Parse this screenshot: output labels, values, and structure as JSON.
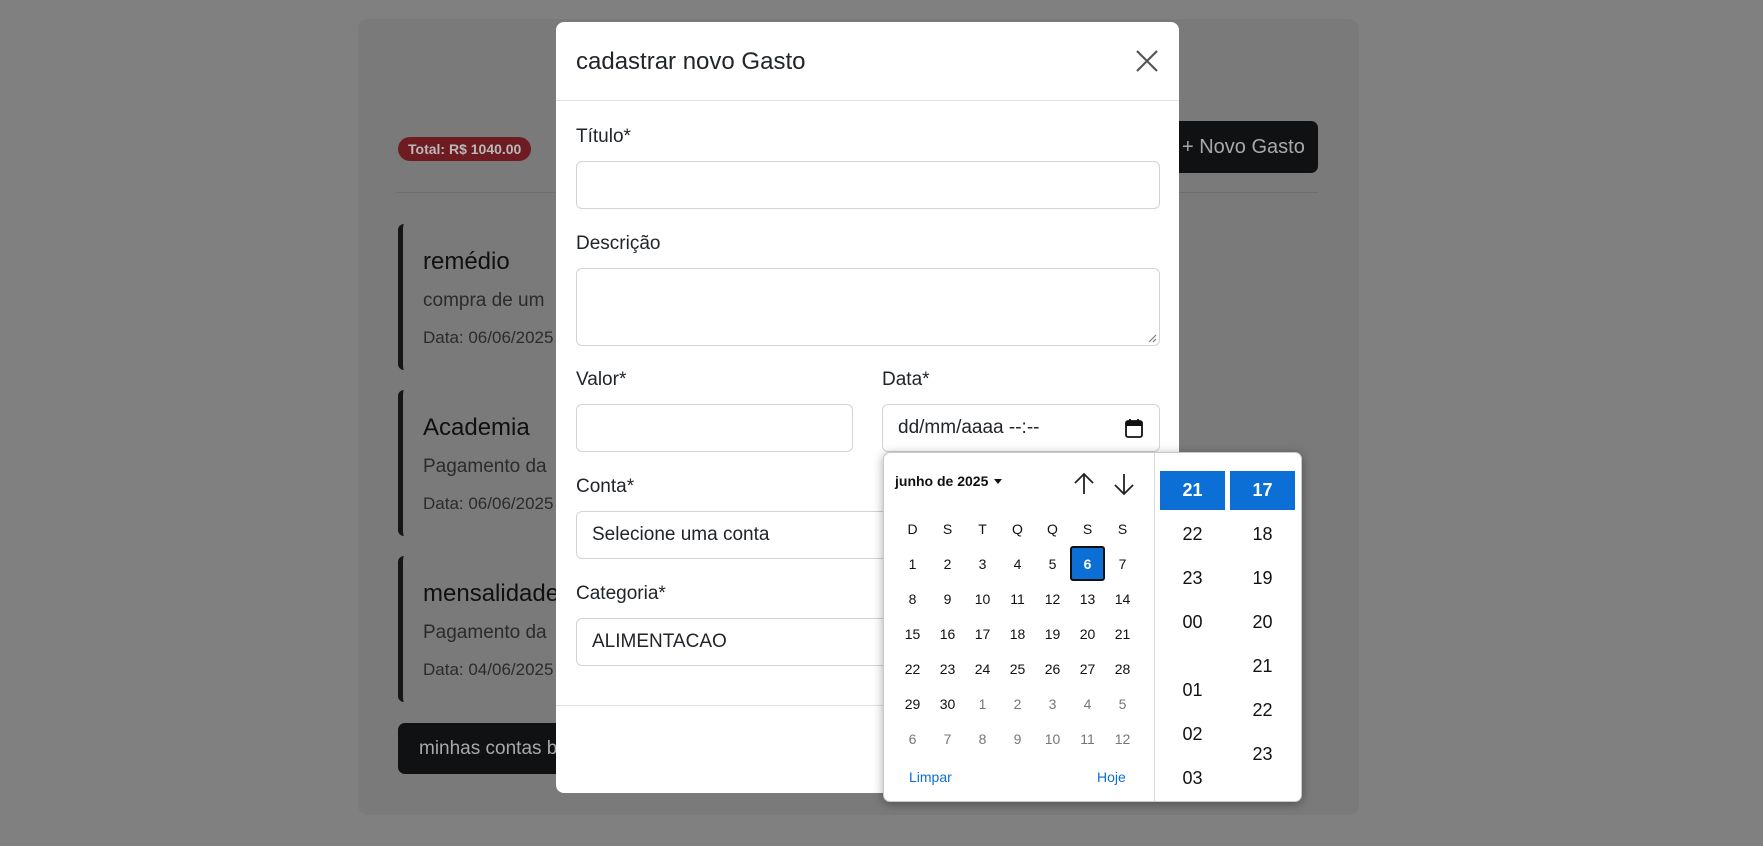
{
  "background": {
    "total_badge": "Total: R$ 1040.00",
    "new_expense_button": "+ Novo Gasto",
    "expenses": [
      {
        "title": "remédio",
        "description": "compra de um",
        "date": "Data: 06/06/2025"
      },
      {
        "title": "Academia",
        "description": "Pagamento da",
        "date": "Data: 06/06/2025"
      },
      {
        "title": "mensalidade",
        "description": "Pagamento da",
        "date": "Data: 04/06/2025"
      }
    ],
    "accounts_button": "minhas contas b"
  },
  "modal": {
    "title": "cadastrar novo Gasto",
    "fields": {
      "titulo": {
        "label": "Título*",
        "value": ""
      },
      "descricao": {
        "label": "Descrição",
        "value": ""
      },
      "valor": {
        "label": "Valor*",
        "value": ""
      },
      "data": {
        "label": "Data*",
        "value": "dd/mm/aaaa --:--"
      },
      "conta": {
        "label": "Conta*",
        "value": "Selecione uma conta"
      },
      "categoria": {
        "label": "Categoria*",
        "value": "ALIMENTACAO"
      }
    }
  },
  "datepicker": {
    "month_label": "junho de 2025",
    "weekdays": [
      "D",
      "S",
      "T",
      "Q",
      "Q",
      "S",
      "S"
    ],
    "weeks": [
      [
        "1",
        "2",
        "3",
        "4",
        "5",
        "6",
        "7"
      ],
      [
        "8",
        "9",
        "10",
        "11",
        "12",
        "13",
        "14"
      ],
      [
        "15",
        "16",
        "17",
        "18",
        "19",
        "20",
        "21"
      ],
      [
        "22",
        "23",
        "24",
        "25",
        "26",
        "27",
        "28"
      ],
      [
        "29",
        "30",
        "1",
        "2",
        "3",
        "4",
        "5"
      ],
      [
        "6",
        "7",
        "8",
        "9",
        "10",
        "11",
        "12"
      ]
    ],
    "selected_day": "6",
    "clear_label": "Limpar",
    "today_label": "Hoje",
    "hours": [
      "21",
      "22",
      "23",
      "00",
      "01",
      "02",
      "03"
    ],
    "selected_hour": "21",
    "minutes": [
      "17",
      "18",
      "19",
      "20",
      "21",
      "22",
      "23"
    ],
    "selected_minute": "17",
    "accent_color": "#0b6fd6"
  }
}
